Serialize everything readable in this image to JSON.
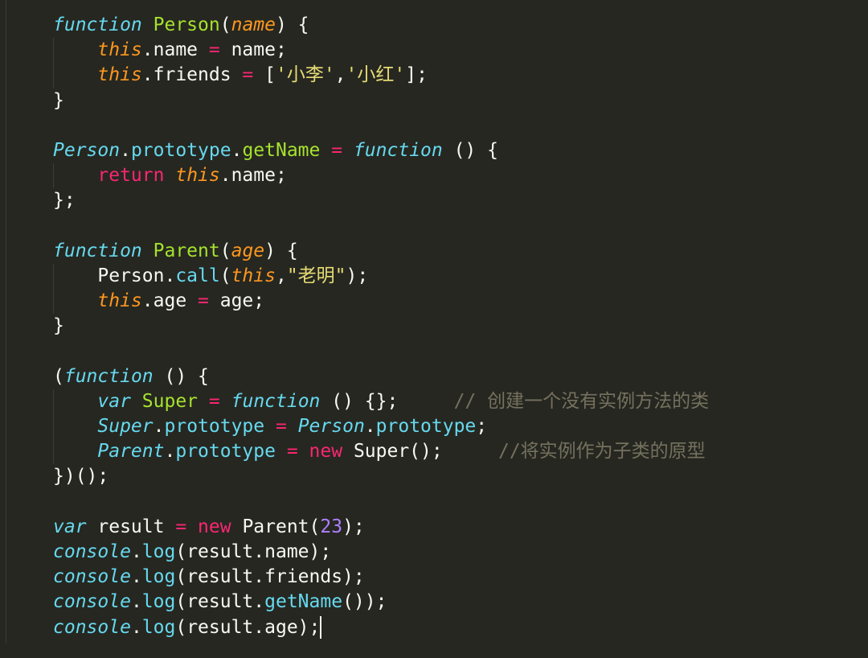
{
  "editor": {
    "theme_colors": {
      "background": "#262721",
      "keyword": "#66d9ef",
      "function_name": "#a6e22e",
      "parameter": "#fd971f",
      "operator": "#f92672",
      "string": "#e6db74",
      "number": "#ae81ff",
      "comment": "#75715e",
      "text": "#f8f8f2"
    },
    "lines": [
      {
        "indent": 0,
        "tokens": [
          {
            "t": "function",
            "c": "kw-it"
          },
          {
            "t": " ",
            "c": "plain"
          },
          {
            "t": "Person",
            "c": "fn"
          },
          {
            "t": "(",
            "c": "plain"
          },
          {
            "t": "name",
            "c": "param"
          },
          {
            "t": ") {",
            "c": "plain"
          }
        ]
      },
      {
        "indent": 1,
        "tokens": [
          {
            "t": "this",
            "c": "this"
          },
          {
            "t": ".name ",
            "c": "plain"
          },
          {
            "t": "=",
            "c": "op"
          },
          {
            "t": " name;",
            "c": "plain"
          }
        ]
      },
      {
        "indent": 1,
        "tokens": [
          {
            "t": "this",
            "c": "this"
          },
          {
            "t": ".friends ",
            "c": "plain"
          },
          {
            "t": "=",
            "c": "op"
          },
          {
            "t": " [",
            "c": "plain"
          },
          {
            "t": "'小李'",
            "c": "str"
          },
          {
            "t": ",",
            "c": "plain"
          },
          {
            "t": "'小红'",
            "c": "str"
          },
          {
            "t": "];",
            "c": "plain"
          }
        ]
      },
      {
        "indent": 0,
        "tokens": [
          {
            "t": "}",
            "c": "plain"
          }
        ]
      },
      {
        "indent": 0,
        "tokens": []
      },
      {
        "indent": 0,
        "tokens": [
          {
            "t": "Person",
            "c": "cls-it"
          },
          {
            "t": ".",
            "c": "plain"
          },
          {
            "t": "prototype",
            "c": "prop"
          },
          {
            "t": ".",
            "c": "plain"
          },
          {
            "t": "getName",
            "c": "fn"
          },
          {
            "t": " ",
            "c": "plain"
          },
          {
            "t": "=",
            "c": "op"
          },
          {
            "t": " ",
            "c": "plain"
          },
          {
            "t": "function",
            "c": "kw-it"
          },
          {
            "t": " () {",
            "c": "plain"
          }
        ]
      },
      {
        "indent": 1,
        "tokens": [
          {
            "t": "return",
            "c": "ret"
          },
          {
            "t": " ",
            "c": "plain"
          },
          {
            "t": "this",
            "c": "this"
          },
          {
            "t": ".name;",
            "c": "plain"
          }
        ]
      },
      {
        "indent": 0,
        "tokens": [
          {
            "t": "};",
            "c": "plain"
          }
        ]
      },
      {
        "indent": 0,
        "tokens": []
      },
      {
        "indent": 0,
        "tokens": [
          {
            "t": "function",
            "c": "kw-it"
          },
          {
            "t": " ",
            "c": "plain"
          },
          {
            "t": "Parent",
            "c": "fn"
          },
          {
            "t": "(",
            "c": "plain"
          },
          {
            "t": "age",
            "c": "param"
          },
          {
            "t": ") {",
            "c": "plain"
          }
        ]
      },
      {
        "indent": 1,
        "tokens": [
          {
            "t": "Person.",
            "c": "plain"
          },
          {
            "t": "call",
            "c": "prop"
          },
          {
            "t": "(",
            "c": "plain"
          },
          {
            "t": "this",
            "c": "this"
          },
          {
            "t": ",",
            "c": "plain"
          },
          {
            "t": "\"老明\"",
            "c": "str"
          },
          {
            "t": ");",
            "c": "plain"
          }
        ]
      },
      {
        "indent": 1,
        "tokens": [
          {
            "t": "this",
            "c": "this"
          },
          {
            "t": ".age ",
            "c": "plain"
          },
          {
            "t": "=",
            "c": "op"
          },
          {
            "t": " age;",
            "c": "plain"
          }
        ]
      },
      {
        "indent": 0,
        "tokens": [
          {
            "t": "}",
            "c": "plain"
          }
        ]
      },
      {
        "indent": 0,
        "tokens": []
      },
      {
        "indent": 0,
        "tokens": [
          {
            "t": "(",
            "c": "plain"
          },
          {
            "t": "function",
            "c": "kw-it"
          },
          {
            "t": " () {",
            "c": "plain"
          }
        ]
      },
      {
        "indent": 1,
        "tokens": [
          {
            "t": "var",
            "c": "kw-it"
          },
          {
            "t": " ",
            "c": "plain"
          },
          {
            "t": "Super",
            "c": "fn"
          },
          {
            "t": " ",
            "c": "plain"
          },
          {
            "t": "=",
            "c": "op"
          },
          {
            "t": " ",
            "c": "plain"
          },
          {
            "t": "function",
            "c": "kw-it"
          },
          {
            "t": " () {};     ",
            "c": "plain"
          },
          {
            "t": "// 创建一个没有实例方法的类",
            "c": "comment"
          }
        ]
      },
      {
        "indent": 1,
        "tokens": [
          {
            "t": "Super",
            "c": "cls-it"
          },
          {
            "t": ".",
            "c": "plain"
          },
          {
            "t": "prototype",
            "c": "prop"
          },
          {
            "t": " ",
            "c": "plain"
          },
          {
            "t": "=",
            "c": "op"
          },
          {
            "t": " ",
            "c": "plain"
          },
          {
            "t": "Person",
            "c": "cls-it"
          },
          {
            "t": ".",
            "c": "plain"
          },
          {
            "t": "prototype",
            "c": "prop"
          },
          {
            "t": ";",
            "c": "plain"
          }
        ]
      },
      {
        "indent": 1,
        "tokens": [
          {
            "t": "Parent",
            "c": "cls-it"
          },
          {
            "t": ".",
            "c": "plain"
          },
          {
            "t": "prototype",
            "c": "prop"
          },
          {
            "t": " ",
            "c": "plain"
          },
          {
            "t": "=",
            "c": "op"
          },
          {
            "t": " ",
            "c": "plain"
          },
          {
            "t": "new",
            "c": "op"
          },
          {
            "t": " Super();     ",
            "c": "plain"
          },
          {
            "t": "//将实例作为子类的原型",
            "c": "comment"
          }
        ]
      },
      {
        "indent": 0,
        "tokens": [
          {
            "t": "})();",
            "c": "plain"
          }
        ]
      },
      {
        "indent": 0,
        "tokens": []
      },
      {
        "indent": 0,
        "tokens": [
          {
            "t": "var",
            "c": "kw-it"
          },
          {
            "t": " result ",
            "c": "plain"
          },
          {
            "t": "=",
            "c": "op"
          },
          {
            "t": " ",
            "c": "plain"
          },
          {
            "t": "new",
            "c": "op"
          },
          {
            "t": " Parent(",
            "c": "plain"
          },
          {
            "t": "23",
            "c": "num"
          },
          {
            "t": ");",
            "c": "plain"
          }
        ]
      },
      {
        "indent": 0,
        "tokens": [
          {
            "t": "console",
            "c": "cls-it"
          },
          {
            "t": ".",
            "c": "plain"
          },
          {
            "t": "log",
            "c": "prop"
          },
          {
            "t": "(result.name);",
            "c": "plain"
          }
        ]
      },
      {
        "indent": 0,
        "tokens": [
          {
            "t": "console",
            "c": "cls-it"
          },
          {
            "t": ".",
            "c": "plain"
          },
          {
            "t": "log",
            "c": "prop"
          },
          {
            "t": "(result.friends);",
            "c": "plain"
          }
        ]
      },
      {
        "indent": 0,
        "tokens": [
          {
            "t": "console",
            "c": "cls-it"
          },
          {
            "t": ".",
            "c": "plain"
          },
          {
            "t": "log",
            "c": "prop"
          },
          {
            "t": "(result.",
            "c": "plain"
          },
          {
            "t": "getName",
            "c": "prop"
          },
          {
            "t": "());",
            "c": "plain"
          }
        ]
      },
      {
        "indent": 0,
        "tokens": [
          {
            "t": "console",
            "c": "cls-it"
          },
          {
            "t": ".",
            "c": "plain"
          },
          {
            "t": "log",
            "c": "prop"
          },
          {
            "t": "(result.age);",
            "c": "plain"
          }
        ],
        "cursor": true
      }
    ]
  }
}
